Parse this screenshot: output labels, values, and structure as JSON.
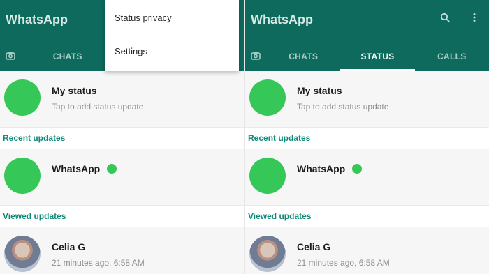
{
  "colors": {
    "accent": "#0d6a5d",
    "green": "#35c757",
    "section": "#0f8a78"
  },
  "left": {
    "app_title": "WhatsApp",
    "tabs": {
      "camera_icon": "camera-icon",
      "chats": "CHATS"
    },
    "menu": {
      "items": [
        "Status privacy",
        "Settings"
      ]
    },
    "my_status": {
      "name": "My status",
      "sub": "Tap to add status update"
    },
    "sections": {
      "recent": "Recent updates",
      "viewed": "Viewed updates"
    },
    "whatsapp": {
      "name": "WhatsApp"
    },
    "contact": {
      "name": "Celia G",
      "sub": "21 minutes ago, 6:58 AM"
    }
  },
  "right": {
    "app_title": "WhatsApp",
    "tabs": {
      "camera_icon": "camera-icon",
      "chats": "CHATS",
      "status": "STATUS",
      "calls": "CALLS"
    },
    "my_status": {
      "name": "My status",
      "sub": "Tap to add status update"
    },
    "sections": {
      "recent": "Recent updates",
      "viewed": "Viewed updates"
    },
    "whatsapp": {
      "name": "WhatsApp"
    },
    "contact": {
      "name": "Celia G",
      "sub": "21 minutes ago, 6:58 AM"
    }
  }
}
